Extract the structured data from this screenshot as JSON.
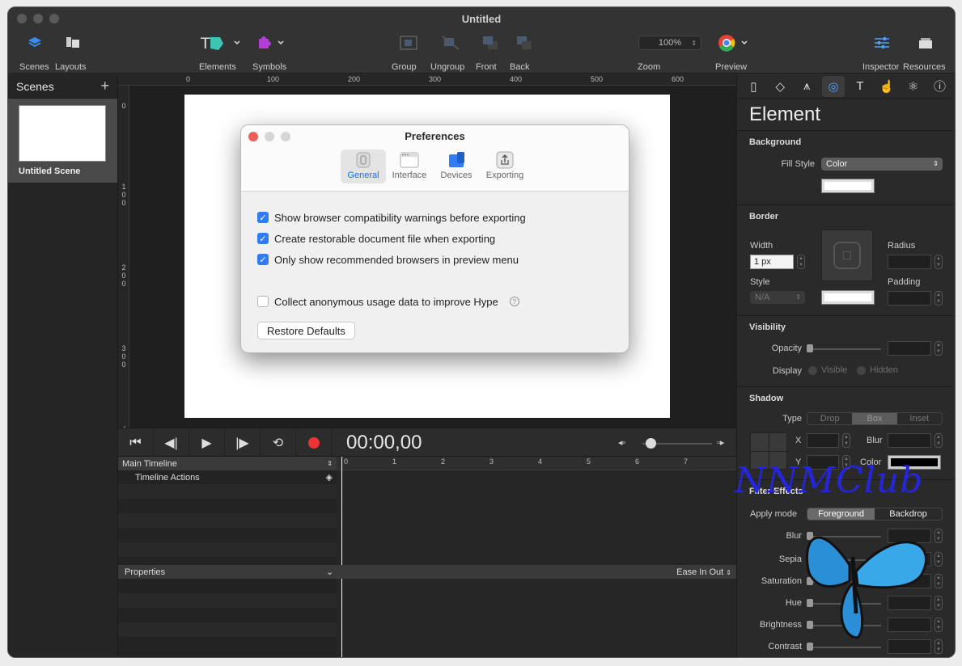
{
  "window": {
    "title": "Untitled"
  },
  "toolbar": {
    "scenes": "Scenes",
    "layouts": "Layouts",
    "elements": "Elements",
    "symbols": "Symbols",
    "group": "Group",
    "ungroup": "Ungroup",
    "front": "Front",
    "back": "Back",
    "zoom": "Zoom",
    "zoom_value": "100%",
    "preview": "Preview",
    "inspector": "Inspector",
    "resources": "Resources"
  },
  "scenes_panel": {
    "title": "Scenes",
    "add": "+",
    "items": [
      {
        "name": "Untitled Scene"
      }
    ]
  },
  "rulers": {
    "h": [
      "0",
      "100",
      "200",
      "300",
      "400",
      "500",
      "600"
    ],
    "v": [
      "0",
      "1\n0\n0",
      "2\n0\n0",
      "3\n0\n0",
      "4"
    ]
  },
  "preferences": {
    "title": "Preferences",
    "tabs": [
      "General",
      "Interface",
      "Devices",
      "Exporting"
    ],
    "selected_tab": "General",
    "checks": [
      {
        "label": "Show browser compatibility warnings before exporting",
        "checked": true
      },
      {
        "label": "Create restorable document file when exporting",
        "checked": true
      },
      {
        "label": "Only show recommended browsers in preview menu",
        "checked": true
      },
      {
        "label": "Collect anonymous usage data to improve Hype",
        "checked": false
      }
    ],
    "help": "?",
    "restore_button": "Restore Defaults"
  },
  "timeline": {
    "timecode": "00:00,00",
    "main_timeline": "Main Timeline",
    "timeline_actions": "Timeline Actions",
    "ticks": [
      "0",
      "1",
      "2",
      "3",
      "4",
      "5",
      "6",
      "7"
    ],
    "properties": "Properties",
    "easing": "Ease In Out"
  },
  "inspector": {
    "title": "Element",
    "background": {
      "title": "Background",
      "fill_style_label": "Fill Style",
      "fill_style_value": "Color"
    },
    "border": {
      "title": "Border",
      "width_label": "Width",
      "width_value": "1 px",
      "radius_label": "Radius",
      "style_label": "Style",
      "style_value": "N/A",
      "padding_label": "Padding"
    },
    "visibility": {
      "title": "Visibility",
      "opacity_label": "Opacity",
      "display_label": "Display",
      "visible": "Visible",
      "hidden": "Hidden"
    },
    "shadow": {
      "title": "Shadow",
      "type_label": "Type",
      "types": [
        "Drop",
        "Box",
        "Inset"
      ],
      "selected": "Box",
      "x_label": "X",
      "y_label": "Y",
      "blur_label": "Blur",
      "color_label": "Color"
    },
    "filter": {
      "title": "Filter Effects",
      "apply_mode_label": "Apply mode",
      "modes": [
        "Foreground",
        "Backdrop"
      ],
      "selected": "Foreground",
      "rows": [
        "Blur",
        "Sepia",
        "Saturation",
        "Hue",
        "Brightness",
        "Contrast"
      ]
    }
  },
  "watermark": "NNMClub"
}
